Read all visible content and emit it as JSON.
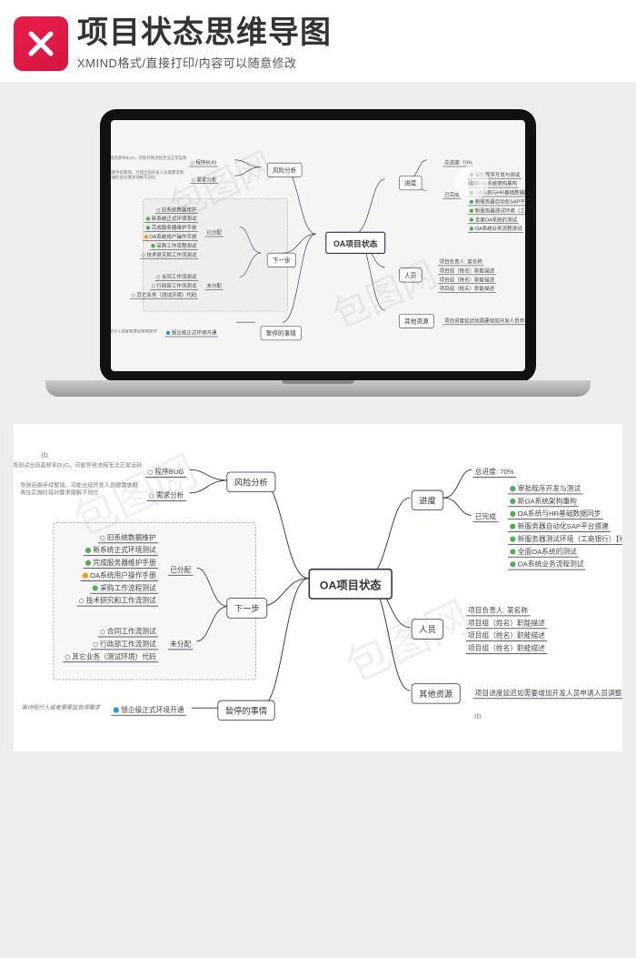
{
  "header": {
    "title": "项目状态思维导图",
    "subtitle": "XMIND格式/直接打印/内容可以随意修改"
  },
  "watermark": "包图网",
  "mindmap": {
    "center": "OA项目状态",
    "branches": {
      "risk": {
        "label": "风险分析",
        "sub1": {
          "label": "程序BUG",
          "note": "本周测试出现高频率BUG，可能导致流程无法正常运转"
        },
        "sub2": {
          "label": "需求分析",
          "note": "导致后期手续繁琐、可能出现开发人员跟需求脱离在实施阶段对需求理解不到位"
        }
      },
      "progress": {
        "label": "进度",
        "total": "总进度: 70%",
        "done_label": "已完成",
        "items": [
          "审批程序开发与测试",
          "新OA系统架构重构",
          "OA系统与HR基础数据同步",
          "新服务器自动化SAP平台搭建",
          "新服务器测试环境（工商银行）【待确认】",
          "全面OA系统的测试",
          "OA系统业务流程测试"
        ]
      },
      "next": {
        "label": "下一步",
        "assigned_label": "已分配",
        "unassigned_label": "未分配",
        "assigned": [
          "旧系统数据维护",
          "新系统正式环境测试",
          "完成服务器维护手册",
          "OA系统用户操作手册",
          "采购工作流程测试",
          "技术研究和工作流测试"
        ],
        "unassigned": [
          "合同工作流测试",
          "行政部工作流测试",
          "其它业务（测试环境）代码"
        ]
      },
      "people": {
        "label": "人员",
        "items": [
          "项目负责人: 某名称",
          "项目组（姓名）职能描述",
          "项目组（姓名）职能描述",
          "项目组（姓名）职能描述"
        ]
      },
      "other": {
        "label": "其他资源",
        "note": "项目进度延迟如需要增加开发人员申请人员调整"
      },
      "pending": {
        "label": "暂停的事情",
        "sub": "银企级正式环境开通",
        "note": "等待税行人或者需要监管理需求"
      }
    }
  }
}
